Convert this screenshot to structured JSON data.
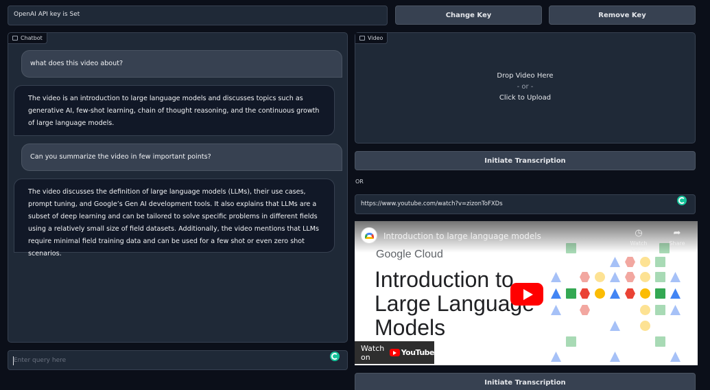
{
  "api": {
    "status_text": "OpenAI API key is Set",
    "change_key_label": "Change Key",
    "remove_key_label": "Remove Key"
  },
  "chatbot": {
    "label": "Chatbot",
    "messages": [
      {
        "role": "user",
        "text": "what does this video about?"
      },
      {
        "role": "bot",
        "text": "The video is an introduction to large language models and discusses topics such as generative AI, few-shot learning, chain of thought reasoning, and the continuous growth of large language models."
      },
      {
        "role": "user",
        "text": "Can you summarize the video in few important points?"
      },
      {
        "role": "bot",
        "text": "The video discusses the definition of large language models (LLMs), their use cases, prompt tuning, and Google’s Gen AI development tools. It also explains that LLMs are a subset of deep learning and can be tailored to solve specific problems in different fields using a relatively small size of field datasets. Additionally, the video mentions that LLMs require minimal field training data and can be used for a few shot or even zero shot scenarios."
      }
    ],
    "query_placeholder": "Enter query here"
  },
  "video": {
    "label": "Video",
    "drop_text": "Drop Video Here",
    "or_text": "- or -",
    "upload_text": "Click to Upload",
    "initiate_label": "Initiate Transcription",
    "or_label": "OR",
    "url_value": "https://www.youtube.com/watch?v=zizonToFXDs",
    "initiate_label_2": "Initiate Transcription"
  },
  "youtube": {
    "title": "Introduction to large language models",
    "watch_later": "Watch Later",
    "share": "Share",
    "brand": "Google Cloud",
    "heading_line1": "Introduction to",
    "heading_line2": "Large Language",
    "heading_line3": "Models",
    "watch_on": "Watch on",
    "youtube_word": "YouTube"
  },
  "colors": {
    "background": "#0b0f19",
    "panel": "#1f2937",
    "button": "#374151",
    "grammarly": "#15c39a",
    "youtube_red": "#ff0000",
    "google_blue": "#4285f4",
    "google_red": "#ea4335",
    "google_yellow": "#fbbc04",
    "google_green": "#34a853"
  }
}
